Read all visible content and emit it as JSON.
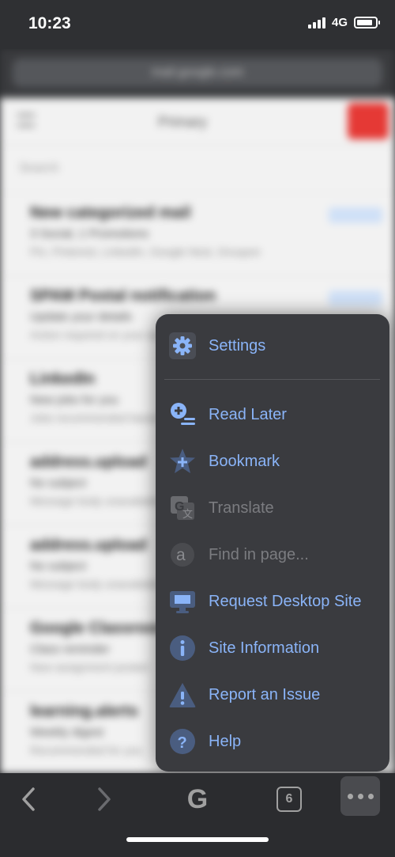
{
  "status_bar": {
    "time": "10:23",
    "network": "4G",
    "battery_level": 0.85
  },
  "browser": {
    "url": "mail.google.com"
  },
  "background_page": {
    "folder": "Primary",
    "search_placeholder": "Search",
    "rows": [
      {
        "sender": "New categorized mail",
        "subject": "3 Social, 1 Promotions",
        "preview": "Pin, Pinterest, LinkedIn, Google Nest, Groupon"
      },
      {
        "sender": "SPAM Postal notification",
        "subject": "Update your details",
        "preview": "Action required on your account"
      },
      {
        "sender": "LinkedIn",
        "subject": "New jobs for you",
        "preview": "Jobs recommended based on your profile"
      },
      {
        "sender": "address.upload",
        "subject": "No subject",
        "preview": "Message body unavailable"
      },
      {
        "sender": "address.upload",
        "subject": "No subject",
        "preview": "Message body unavailable"
      },
      {
        "sender": "Google Classroom",
        "subject": "Class reminder",
        "preview": "New assignment posted"
      },
      {
        "sender": "learning.alerts",
        "subject": "Weekly digest",
        "preview": "Recommended for you"
      }
    ]
  },
  "menu": {
    "items": [
      {
        "label": "Settings",
        "icon": "gear-icon",
        "enabled": true
      },
      {
        "label": "Read Later",
        "icon": "read-later-icon",
        "enabled": true
      },
      {
        "label": "Bookmark",
        "icon": "bookmark-star-icon",
        "enabled": true
      },
      {
        "label": "Translate",
        "icon": "translate-icon",
        "enabled": false
      },
      {
        "label": "Find in page...",
        "icon": "find-in-page-icon",
        "enabled": false
      },
      {
        "label": "Request Desktop Site",
        "icon": "desktop-icon",
        "enabled": true
      },
      {
        "label": "Site Information",
        "icon": "info-icon",
        "enabled": true
      },
      {
        "label": "Report an Issue",
        "icon": "warning-icon",
        "enabled": true
      },
      {
        "label": "Help",
        "icon": "help-icon",
        "enabled": true
      }
    ]
  },
  "toolbar": {
    "google_label": "G",
    "tab_count": "6"
  },
  "colors": {
    "accent": "#8ab4f8",
    "menu_bg": "#3a3b3f",
    "disabled": "#7b7c80"
  }
}
